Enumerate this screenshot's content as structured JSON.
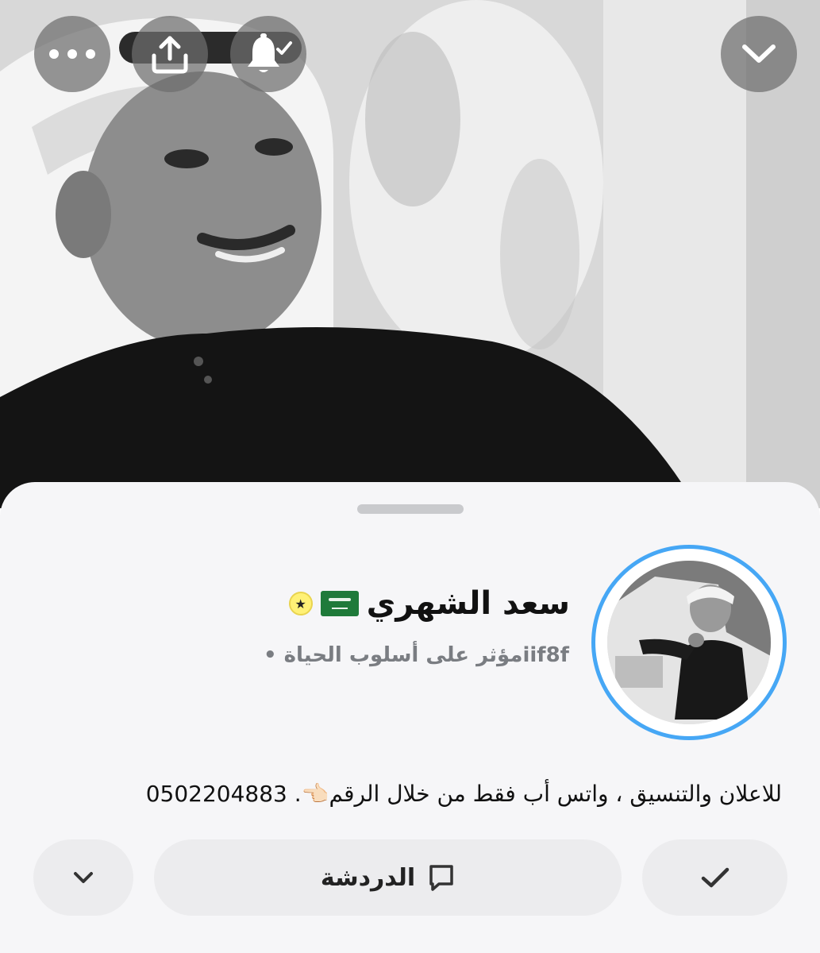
{
  "header": {
    "buttons": [
      {
        "name": "more-options",
        "icon": "ellipsis-icon"
      },
      {
        "name": "share",
        "icon": "share-upload-icon"
      },
      {
        "name": "notifications",
        "icon": "bell-check-icon"
      },
      {
        "name": "collapse",
        "icon": "chevron-down-icon"
      }
    ]
  },
  "profile": {
    "name": "سعد الشهري",
    "flag": "saudi-flag-icon",
    "badge": "star-badge-icon",
    "subtitle": "iif8fمؤثر على أسلوب الحياة •",
    "bio": "للاعلان والتنسيق ، واتس أب فقط من خلال الرقم👈🏻. 0502204883",
    "avatar_ring_color": "#46a7f5"
  },
  "actions": {
    "chat_label": "الدردشة",
    "chat_icon": "chat-bubble-icon",
    "follow_icon": "checkmark-icon",
    "more_icon": "chevron-down-icon"
  }
}
